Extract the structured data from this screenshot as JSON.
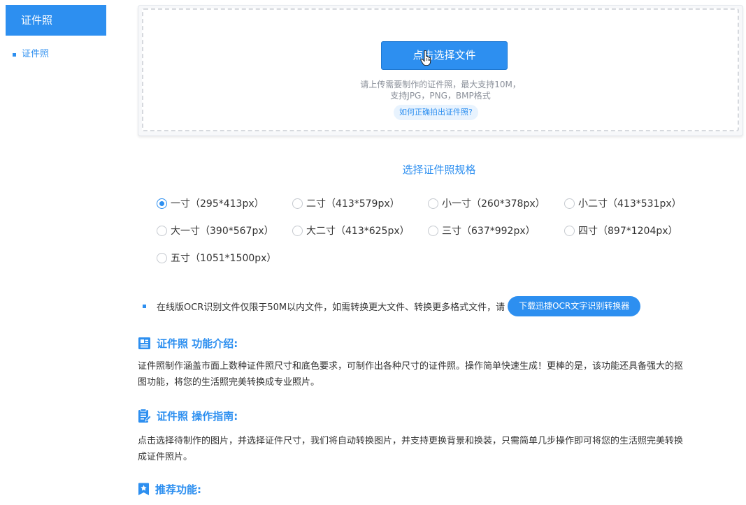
{
  "sidebar": {
    "title": "证件照",
    "items": [
      {
        "label": "证件照"
      }
    ]
  },
  "upload": {
    "button_label": "点击选择文件",
    "hint_line1": "请上传需要制作的证件照，最大支持10M，",
    "hint_line2": "支持JPG，PNG，BMP格式",
    "help_link": "如何正确拍出证件照?"
  },
  "spec": {
    "title": "选择证件照规格",
    "selected": "一寸（295*413px）",
    "options": [
      {
        "label": "一寸（295*413px）"
      },
      {
        "label": "二寸（413*579px）"
      },
      {
        "label": "小一寸（260*378px）"
      },
      {
        "label": "小二寸（413*531px）"
      },
      {
        "label": "大一寸（390*567px）"
      },
      {
        "label": "大二寸（413*625px）"
      },
      {
        "label": "三寸（637*992px）"
      },
      {
        "label": "四寸（897*1204px）"
      },
      {
        "label": "五寸（1051*1500px）"
      }
    ]
  },
  "notice": {
    "text": "在线版OCR识别文件仅限于50M以内文件，如需转换更大文件、转换更多格式文件，请",
    "button_label": "下载迅捷OCR文字识别转换器"
  },
  "sections": {
    "intro": {
      "heading": "证件照 功能介绍:",
      "line1": "证件照制作涵盖市面上数种证件照尺寸和底色要求，可制作出各种尺寸的证件照。操作简单快速生成！更棒的是，该功能还具备强大的抠",
      "line2": "图功能，将您的生活照完美转换成专业照片。"
    },
    "guide": {
      "heading": "证件照 操作指南:",
      "line1": "点击选择待制作的图片，并选择证件尺寸，我们将自动转换图片，并支持更换背景和换装，只需简单几步操作即可将您的生活照完美转换",
      "line2": "成证件照片。"
    },
    "recommend": {
      "heading": "推荐功能:"
    }
  },
  "colors": {
    "accent": "#2d8ff0",
    "text": "#333333",
    "hint": "#8a8f99"
  }
}
